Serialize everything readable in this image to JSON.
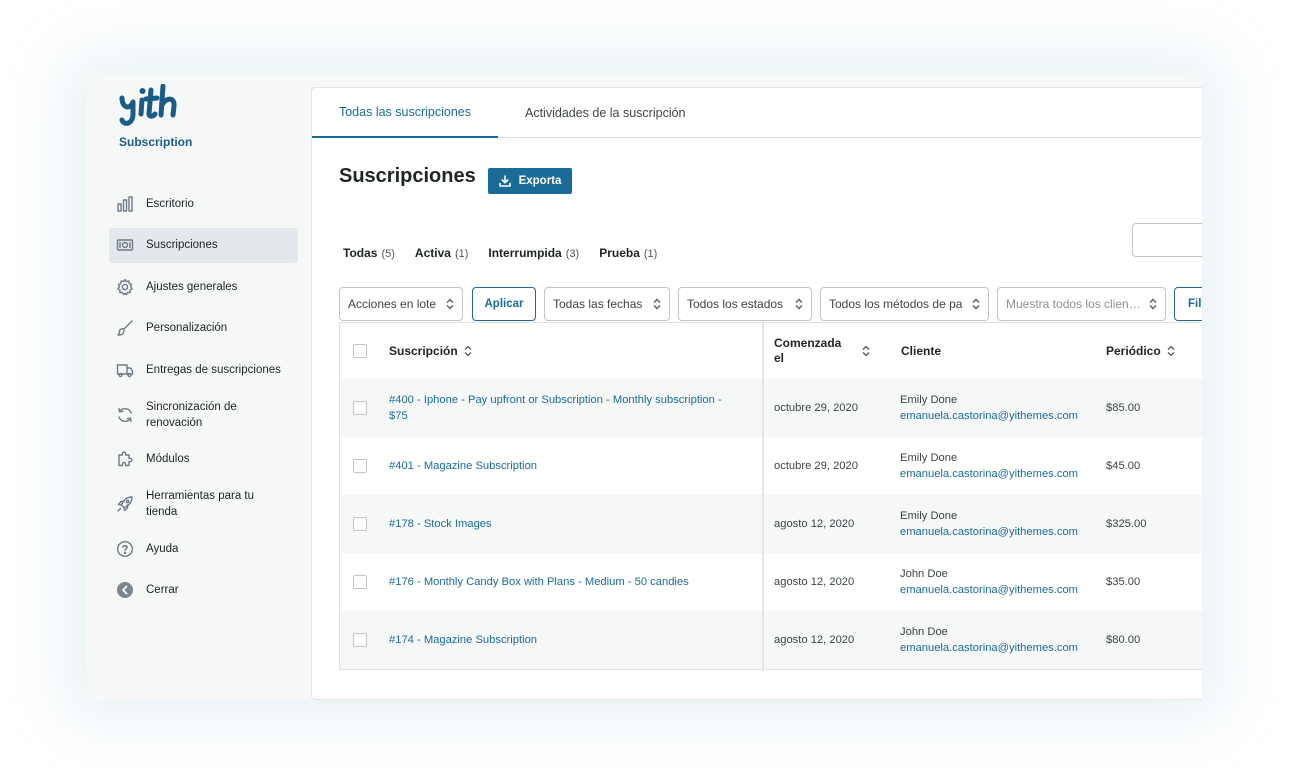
{
  "sidebar": {
    "plugin_name": "Subscription",
    "items": [
      {
        "label": "Escritorio",
        "icon": "bar-chart-icon"
      },
      {
        "label": "Suscripciones",
        "icon": "money-icon"
      },
      {
        "label": "Ajustes generales",
        "icon": "gear-icon"
      },
      {
        "label": "Personalización",
        "icon": "brush-icon"
      },
      {
        "label": "Entregas de suscripciones",
        "icon": "truck-icon"
      },
      {
        "label": "Sincronización de renovación",
        "icon": "refresh-icon"
      },
      {
        "label": "Módulos",
        "icon": "puzzle-icon"
      },
      {
        "label": "Herramientas para tu tienda",
        "icon": "rocket-icon"
      },
      {
        "label": "Ayuda",
        "icon": "help-icon"
      },
      {
        "label": "Cerrar",
        "icon": "close-circle-icon"
      }
    ]
  },
  "tabs": [
    {
      "label": "Todas las suscripciones",
      "active": true
    },
    {
      "label": "Actividades de la suscripción",
      "active": false
    }
  ],
  "page": {
    "title": "Suscripciones",
    "export_label": "Exporta"
  },
  "views": [
    {
      "label": "Todas",
      "count": "(5)"
    },
    {
      "label": "Activa",
      "count": "(1)"
    },
    {
      "label": "Interrumpida",
      "count": "(3)"
    },
    {
      "label": "Prueba",
      "count": "(1)"
    }
  ],
  "filters": {
    "bulk_actions": "Acciones en lote",
    "apply": "Aplicar",
    "dates": "Todas las fechas",
    "states": "Todos los estados",
    "payment_methods": "Todos los métodos de pa",
    "customers_placeholder": "Muestra todos los clien…",
    "filter_button": "Filt"
  },
  "table": {
    "headers": {
      "subscription": "Suscripción",
      "started_line1": "Comenzada",
      "started_line2": "el",
      "customer": "Cliente",
      "period": "Periódico"
    },
    "rows": [
      {
        "title_line1": "#400 - Iphone - Pay upfront or Subscription - Monthly subscription -",
        "title_line2": "$75",
        "date": "octubre 29, 2020",
        "customer_name": "Emily Done",
        "customer_email": "emanuela.castorina@yithemes.com",
        "amount": "$85.00"
      },
      {
        "title_line1": "#401 - Magazine Subscription",
        "title_line2": "",
        "date": "octubre 29, 2020",
        "customer_name": "Emily Done",
        "customer_email": "emanuela.castorina@yithemes.com",
        "amount": "$45.00"
      },
      {
        "title_line1": "#178 - Stock Images",
        "title_line2": "",
        "date": "agosto 12, 2020",
        "customer_name": "Emily Done",
        "customer_email": "emanuela.castorina@yithemes.com",
        "amount": "$325.00"
      },
      {
        "title_line1": "#176 - Monthly Candy Box with Plans - Medium - 50 candies",
        "title_line2": "",
        "date": "agosto 12, 2020",
        "customer_name": "John Doe",
        "customer_email": "emanuela.castorina@yithemes.com",
        "amount": "$35.00"
      },
      {
        "title_line1": "#174 - Magazine Subscription",
        "title_line2": "",
        "date": "agosto 12, 2020",
        "customer_name": "John Doe",
        "customer_email": "emanuela.castorina@yithemes.com",
        "amount": "$80.00"
      }
    ]
  },
  "colors": {
    "accent": "#1b6b97",
    "logo": "#1a5c87"
  }
}
